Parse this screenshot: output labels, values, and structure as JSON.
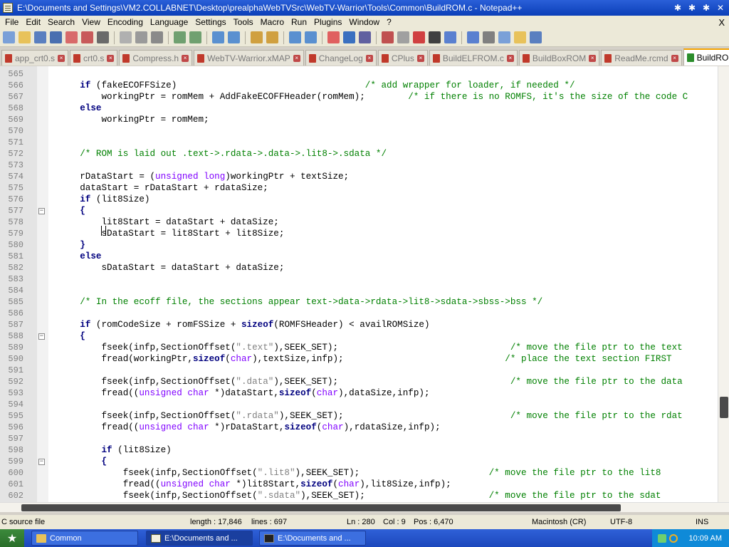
{
  "window": {
    "title": "E:\\Documents and Settings\\VM2.COLLABNET\\Desktop\\prealphaWebTVSrc\\WebTV-Warrior\\Tools\\Common\\BuildROM.c - Notepad++",
    "buttons": [
      "✱",
      "✱",
      "✱",
      "✕"
    ]
  },
  "menu": [
    "File",
    "Edit",
    "Search",
    "View",
    "Encoding",
    "Language",
    "Settings",
    "Tools",
    "Macro",
    "Run",
    "Plugins",
    "Window",
    "?"
  ],
  "menu_close": "X",
  "toolbar": {
    "icons": [
      "new-icon",
      "open-icon",
      "save-icon",
      "save-all-icon",
      "close-icon",
      "close-all-icon",
      "print-icon",
      "sep",
      "cut-icon",
      "copy-icon",
      "paste-icon",
      "sep",
      "undo-icon",
      "redo-icon",
      "sep",
      "find-icon",
      "replace-icon",
      "sep",
      "zoom-in-icon",
      "zoom-out-icon",
      "sep",
      "sync-v-icon",
      "sync-h-icon",
      "sep",
      "wrap-icon",
      "show-all-icon",
      "indent-guide-icon",
      "sep",
      "user-lang-icon",
      "doc-map-icon",
      "function-list-icon",
      "folder-workspace-icon",
      "monitor-icon",
      "sep",
      "record-macro-icon",
      "stop-macro-icon",
      "play-macro-icon",
      "play-multi-icon",
      "save-macro-icon"
    ]
  },
  "tabs": [
    {
      "label": "app_crt0.s",
      "active": false
    },
    {
      "label": "crt0.s",
      "active": false
    },
    {
      "label": "Compress.h",
      "active": false
    },
    {
      "label": "WebTV-Warrior.xMAP",
      "active": false
    },
    {
      "label": "ChangeLog",
      "active": false
    },
    {
      "label": "CPlus",
      "active": false
    },
    {
      "label": "BuildELFROM.c",
      "active": false
    },
    {
      "label": "BuildBoxROM",
      "active": false
    },
    {
      "label": "ReadMe.rcmd",
      "active": false
    },
    {
      "label": "BuildROM.c",
      "active": true
    }
  ],
  "code_lines": [
    {
      "n": "565",
      "fold": "",
      "segs": []
    },
    {
      "n": "566",
      "fold": "",
      "segs": [
        {
          "t": "    "
        },
        {
          "t": "if",
          "c": "kw"
        },
        {
          "t": " (fakeECOFFSize)                                   "
        },
        {
          "t": "/* add wrapper for loader, if needed */",
          "c": "cm"
        }
      ]
    },
    {
      "n": "567",
      "fold": "",
      "segs": [
        {
          "t": "        workingPtr = romMem + AddFakeECOFFHeader(romMem);        "
        },
        {
          "t": "/* if there is no ROMFS, it's the size of the code C",
          "c": "cm"
        }
      ]
    },
    {
      "n": "568",
      "fold": "",
      "segs": [
        {
          "t": "    "
        },
        {
          "t": "else",
          "c": "kw"
        }
      ]
    },
    {
      "n": "569",
      "fold": "",
      "segs": [
        {
          "t": "        workingPtr = romMem;"
        }
      ]
    },
    {
      "n": "570",
      "fold": "",
      "segs": []
    },
    {
      "n": "571",
      "fold": "",
      "segs": []
    },
    {
      "n": "572",
      "fold": "",
      "segs": [
        {
          "t": "    "
        },
        {
          "t": "/* ROM is laid out .text->.rdata->.data->.lit8->.sdata */",
          "c": "cm"
        }
      ]
    },
    {
      "n": "573",
      "fold": "",
      "segs": []
    },
    {
      "n": "574",
      "fold": "",
      "segs": [
        {
          "t": "    rDataStart = ("
        },
        {
          "t": "unsigned long",
          "c": "ty"
        },
        {
          "t": ")workingPtr + textSize;"
        }
      ]
    },
    {
      "n": "575",
      "fold": "",
      "segs": [
        {
          "t": "    dataStart = rDataStart + rdataSize;"
        }
      ]
    },
    {
      "n": "576",
      "fold": "",
      "segs": [
        {
          "t": "    "
        },
        {
          "t": "if",
          "c": "kw"
        },
        {
          "t": " (lit8Size)"
        }
      ]
    },
    {
      "n": "577",
      "fold": "−",
      "segs": [
        {
          "t": "    "
        },
        {
          "t": "{",
          "c": "kw"
        }
      ]
    },
    {
      "n": "578",
      "fold": "",
      "segs": [
        {
          "t": "        lit8Start = dataStart + dataSize;"
        }
      ]
    },
    {
      "n": "579",
      "fold": "",
      "segs": [
        {
          "t": "        sDataStart = lit8Start + lit8Size;"
        }
      ]
    },
    {
      "n": "580",
      "fold": "",
      "segs": [
        {
          "t": "    "
        },
        {
          "t": "}",
          "c": "kw"
        }
      ]
    },
    {
      "n": "581",
      "fold": "",
      "segs": [
        {
          "t": "    "
        },
        {
          "t": "else",
          "c": "kw"
        }
      ]
    },
    {
      "n": "582",
      "fold": "",
      "segs": [
        {
          "t": "        sDataStart = dataStart + dataSize;"
        }
      ]
    },
    {
      "n": "583",
      "fold": "",
      "segs": []
    },
    {
      "n": "584",
      "fold": "",
      "segs": []
    },
    {
      "n": "585",
      "fold": "",
      "segs": [
        {
          "t": "    "
        },
        {
          "t": "/* In the ecoff file, the sections appear text->data->rdata->lit8->sdata->sbss->bss */",
          "c": "cm"
        }
      ]
    },
    {
      "n": "586",
      "fold": "",
      "segs": []
    },
    {
      "n": "587",
      "fold": "",
      "segs": [
        {
          "t": "    "
        },
        {
          "t": "if",
          "c": "kw"
        },
        {
          "t": " (romCodeSize + romFSSize + "
        },
        {
          "t": "sizeof",
          "c": "kw"
        },
        {
          "t": "(ROMFSHeader) < availROMSize)"
        }
      ]
    },
    {
      "n": "588",
      "fold": "−",
      "segs": [
        {
          "t": "    "
        },
        {
          "t": "{",
          "c": "kw"
        }
      ]
    },
    {
      "n": "589",
      "fold": "",
      "segs": [
        {
          "t": "        fseek(infp,SectionOffset("
        },
        {
          "t": "\".text\"",
          "c": "st"
        },
        {
          "t": "),SEEK_SET);                                "
        },
        {
          "t": "/* move the file ptr to the text",
          "c": "cm"
        }
      ]
    },
    {
      "n": "590",
      "fold": "",
      "segs": [
        {
          "t": "        fread(workingPtr,"
        },
        {
          "t": "sizeof",
          "c": "kw"
        },
        {
          "t": "("
        },
        {
          "t": "char",
          "c": "ty"
        },
        {
          "t": "),textSize,infp);                              "
        },
        {
          "t": "/* place the text section FIRST",
          "c": "cm"
        }
      ]
    },
    {
      "n": "591",
      "fold": "",
      "segs": []
    },
    {
      "n": "592",
      "fold": "",
      "segs": [
        {
          "t": "        fseek(infp,SectionOffset("
        },
        {
          "t": "\".data\"",
          "c": "st"
        },
        {
          "t": "),SEEK_SET);                                "
        },
        {
          "t": "/* move the file ptr to the data",
          "c": "cm"
        }
      ]
    },
    {
      "n": "593",
      "fold": "",
      "segs": [
        {
          "t": "        fread(("
        },
        {
          "t": "unsigned char",
          "c": "ty"
        },
        {
          "t": " *)dataStart,"
        },
        {
          "t": "sizeof",
          "c": "kw"
        },
        {
          "t": "("
        },
        {
          "t": "char",
          "c": "ty"
        },
        {
          "t": "),dataSize,infp);"
        }
      ]
    },
    {
      "n": "594",
      "fold": "",
      "segs": []
    },
    {
      "n": "595",
      "fold": "",
      "segs": [
        {
          "t": "        fseek(infp,SectionOffset("
        },
        {
          "t": "\".rdata\"",
          "c": "st"
        },
        {
          "t": "),SEEK_SET);                               "
        },
        {
          "t": "/* move the file ptr to the rdat",
          "c": "cm"
        }
      ]
    },
    {
      "n": "596",
      "fold": "",
      "segs": [
        {
          "t": "        fread(("
        },
        {
          "t": "unsigned char",
          "c": "ty"
        },
        {
          "t": " *)rDataStart,"
        },
        {
          "t": "sizeof",
          "c": "kw"
        },
        {
          "t": "("
        },
        {
          "t": "char",
          "c": "ty"
        },
        {
          "t": "),rdataSize,infp);"
        }
      ]
    },
    {
      "n": "597",
      "fold": "",
      "segs": []
    },
    {
      "n": "598",
      "fold": "",
      "segs": [
        {
          "t": "        "
        },
        {
          "t": "if",
          "c": "kw"
        },
        {
          "t": " (lit8Size)"
        }
      ]
    },
    {
      "n": "599",
      "fold": "−",
      "segs": [
        {
          "t": "        "
        },
        {
          "t": "{",
          "c": "kw"
        }
      ]
    },
    {
      "n": "600",
      "fold": "",
      "segs": [
        {
          "t": "            fseek(infp,SectionOffset("
        },
        {
          "t": "\".lit8\"",
          "c": "st"
        },
        {
          "t": "),SEEK_SET);                        "
        },
        {
          "t": "/* move the file ptr to the lit8",
          "c": "cm"
        }
      ]
    },
    {
      "n": "601",
      "fold": "",
      "segs": [
        {
          "t": "            fread(("
        },
        {
          "t": "unsigned char",
          "c": "ty"
        },
        {
          "t": " *)lit8Start,"
        },
        {
          "t": "sizeof",
          "c": "kw"
        },
        {
          "t": "("
        },
        {
          "t": "char",
          "c": "ty"
        },
        {
          "t": "),lit8Size,infp);"
        }
      ]
    },
    {
      "n": "602",
      "fold": "",
      "segs": [
        {
          "t": "            fseek(infp,SectionOffset("
        },
        {
          "t": "\".sdata\"",
          "c": "st"
        },
        {
          "t": "),SEEK_SET);                       "
        },
        {
          "t": "/* move the file ptr to the sdat",
          "c": "cm"
        }
      ]
    }
  ],
  "status": {
    "file_type": "C source file",
    "length": "length : 17,846",
    "lines": "lines : 697",
    "ln": "Ln : 280",
    "col": "Col : 9",
    "pos": "Pos : 6,470",
    "eol": "Macintosh (CR)",
    "encoding": "UTF-8",
    "mode": "INS"
  },
  "taskbar": {
    "start_icon": "windows-flag-icon",
    "tasks": [
      {
        "label": "Common",
        "icon": "folder-icon"
      },
      {
        "label": "E:\\Documents and ...",
        "icon": "notepadpp-icon"
      },
      {
        "label": "E:\\Documents and ...",
        "icon": "cmd-icon"
      }
    ],
    "clock": "10:09 AM"
  },
  "colors": {
    "keyword": "#00007f",
    "type": "#8000ff",
    "comment": "#008000",
    "string": "#808080",
    "title_bar": "#0b3fb8",
    "taskbar": "#1c48bc"
  }
}
